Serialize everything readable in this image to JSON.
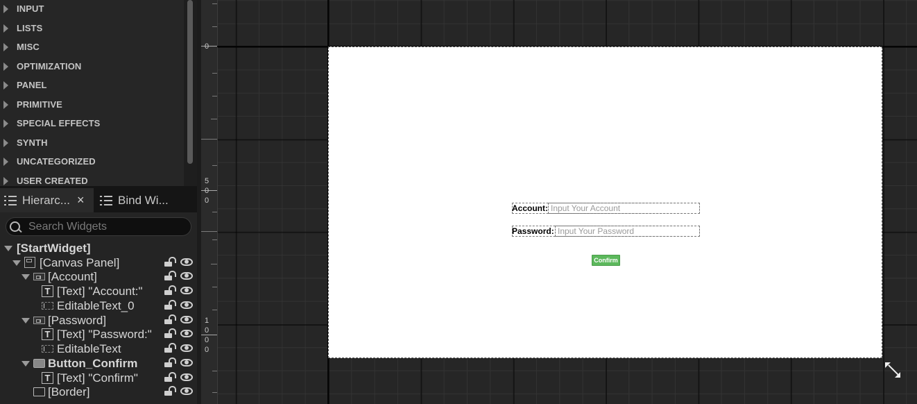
{
  "palette": {
    "categories": [
      "INPUT",
      "LISTS",
      "MISC",
      "OPTIMIZATION",
      "PANEL",
      "PRIMITIVE",
      "SPECIAL EFFECTS",
      "SYNTH",
      "UNCATEGORIZED",
      "USER CREATED"
    ]
  },
  "tabs": {
    "hierarchy": "Hierarc...",
    "close": "×",
    "bind_widgets": "Bind Wi..."
  },
  "search": {
    "placeholder": "Search Widgets",
    "value": ""
  },
  "tree": {
    "root": "[StartWidget]",
    "canvas_panel": "[Canvas Panel]",
    "account": "[Account]",
    "account_text": "[Text] \"Account:\"",
    "editable_text_0": "EditableText_0",
    "password": "[Password]",
    "password_text": "[Text] \"Password:\"",
    "editable_text": "EditableText",
    "button_confirm": "Button_Confirm",
    "confirm_text": "[Text] \"Confirm\"",
    "border": "[Border]"
  },
  "ruler": {
    "mark_0": [
      "0"
    ],
    "mark_500": [
      "5",
      "0",
      "0"
    ],
    "mark_1000": [
      "1",
      "0",
      "0",
      "0"
    ]
  },
  "preview": {
    "account_label": "Account:",
    "account_placeholder": "Input Your Account",
    "password_label": "Password:",
    "password_placeholder": "Input Your Password",
    "confirm_label": "Confirm",
    "confirm_color": "#5cb85c"
  },
  "colors": {
    "panel_bg": "#262626",
    "canvas_bg": "#ffffff"
  }
}
